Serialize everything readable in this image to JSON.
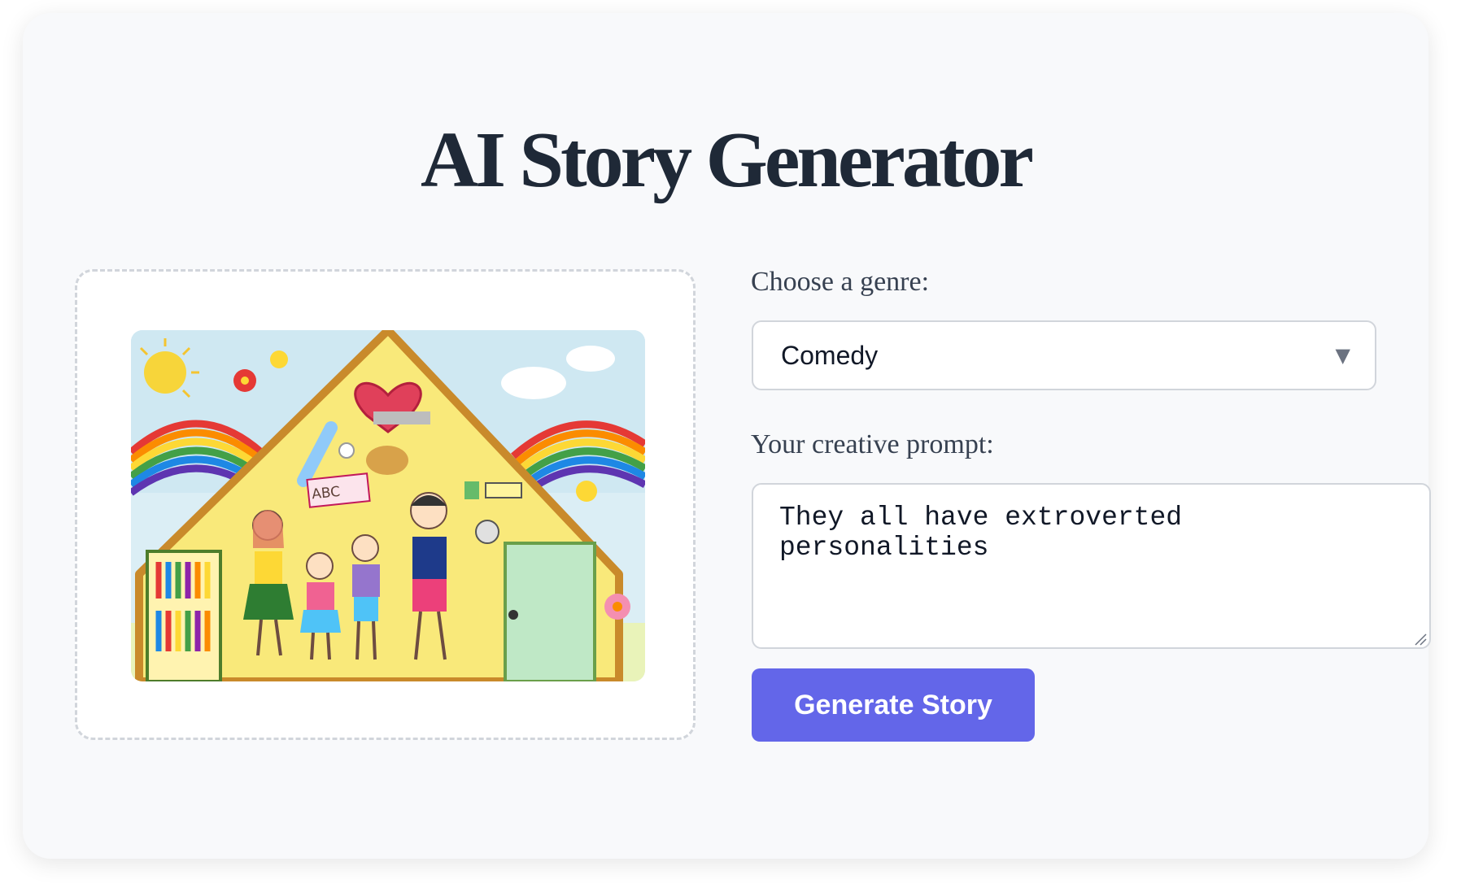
{
  "app": {
    "title": "AI Story Generator"
  },
  "upload": {
    "image_description_icon": "crayon-drawing-image",
    "drawing_text": {
      "book_label": "ABC Book"
    }
  },
  "form": {
    "genre_label": "Choose a genre:",
    "genre_value": "Comedy",
    "genre_icon": "triangle-down-icon",
    "prompt_label": "Your creative prompt:",
    "prompt_value": "They all have extroverted personalities",
    "submit_label": "Generate Story"
  },
  "colors": {
    "accent": "#6366e9",
    "title": "#1f2937",
    "label": "#374151",
    "card_bg": "#f8f9fb",
    "border": "#d1d5db"
  }
}
